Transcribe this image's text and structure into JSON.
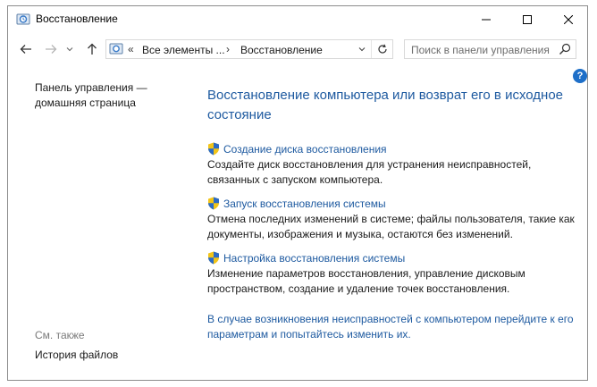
{
  "window": {
    "title": "Восстановление",
    "controls": {
      "minimize": "—",
      "maximize": "☐",
      "close": "✕"
    }
  },
  "address": {
    "chevron": "«",
    "crumbs": [
      "Все элементы ...",
      "Восстановление"
    ],
    "separator": "›"
  },
  "search": {
    "placeholder": "Поиск в панели управления"
  },
  "help": {
    "label": "?"
  },
  "left_pane": {
    "home_link": "Панель управления — домашняя страница",
    "see_also_label": "См. также",
    "see_also_items": [
      "История файлов"
    ]
  },
  "main": {
    "title": "Восстановление компьютера или возврат его в исходное состояние",
    "items": [
      {
        "link": "Создание диска восстановления",
        "desc": "Создайте диск восстановления для устранения неисправностей, связанных с запуском компьютера."
      },
      {
        "link": "Запуск восстановления системы",
        "desc": "Отмена последних изменений в системе; файлы пользователя, такие как документы, изображения и музыка, остаются без изменений."
      },
      {
        "link": "Настройка восстановления системы",
        "desc": "Изменение параметров восстановления, управление дисковым пространством, создание и удаление точек восстановления."
      }
    ],
    "bottom_note": "В случае возникновения неисправностей с компьютером перейдите к его параметрам и попытайтесь изменить их."
  },
  "colors": {
    "link": "#1e5aa0",
    "help": "#1e6fc8",
    "muted": "#7a7a7a"
  }
}
